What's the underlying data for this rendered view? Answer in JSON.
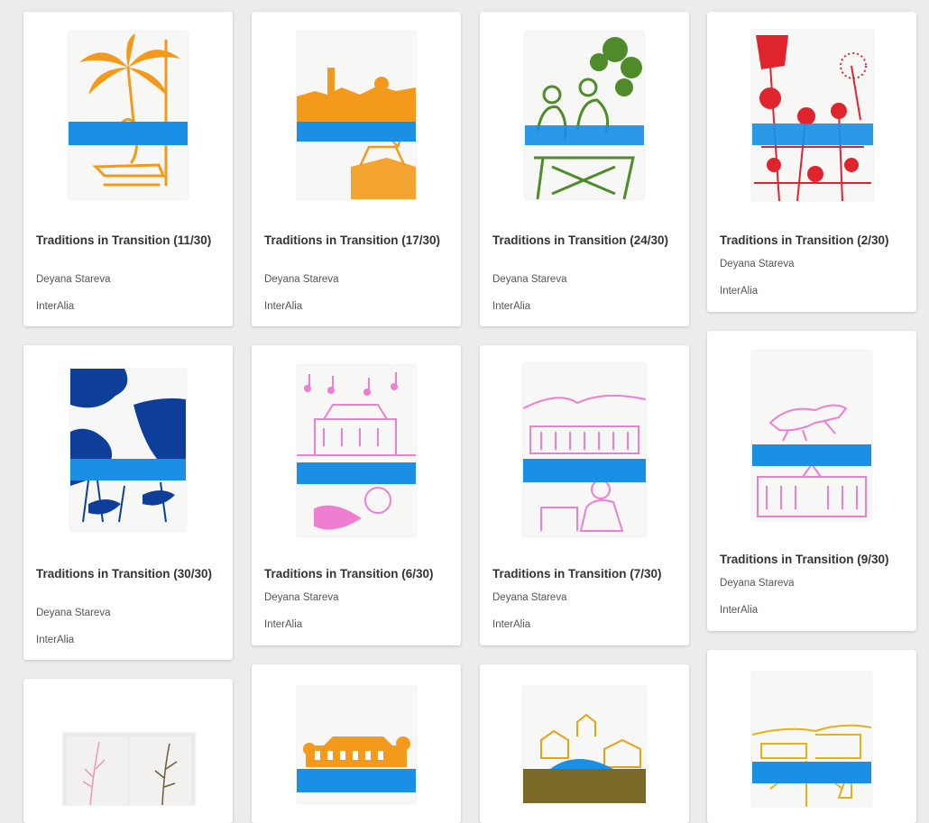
{
  "cards": [
    {
      "title": "Traditions in Transition (11/30)",
      "artist": "Deyana Stareva",
      "gallery": "InterAlia",
      "palette": "orange",
      "icon": "palm-tree-artwork"
    },
    {
      "title": "Traditions in Transition (17/30)",
      "artist": "Deyana Stareva",
      "gallery": "InterAlia",
      "palette": "orange",
      "icon": "coastal-town-artwork"
    },
    {
      "title": "Traditions in Transition (24/30)",
      "artist": "Deyana Stareva",
      "gallery": "InterAlia",
      "palette": "green",
      "icon": "people-table-artwork"
    },
    {
      "title": "Traditions in Transition (2/30)",
      "artist": "Deyana Stareva",
      "gallery": "InterAlia",
      "palette": "red",
      "icon": "flowers-artwork"
    },
    {
      "title": "Traditions in Transition (30/30)",
      "artist": "Deyana Stareva",
      "gallery": "InterAlia",
      "palette": "navy",
      "icon": "abstract-blue-artwork"
    },
    {
      "title": "Traditions in Transition (6/30)",
      "artist": "Deyana Stareva",
      "gallery": "InterAlia",
      "palette": "pink",
      "icon": "music-house-artwork"
    },
    {
      "title": "Traditions in Transition (7/30)",
      "artist": "Deyana Stareva",
      "gallery": "InterAlia",
      "palette": "pink",
      "icon": "building-figure-artwork"
    },
    {
      "title": "Traditions in Transition (9/30)",
      "artist": "Deyana Stareva",
      "gallery": "InterAlia",
      "palette": "pink",
      "icon": "horse-palace-artwork"
    },
    {
      "title": "",
      "artist": "",
      "gallery": "",
      "palette": "sketchbook",
      "icon": "sketchbook-artwork"
    },
    {
      "title": "",
      "artist": "",
      "gallery": "",
      "palette": "orange",
      "icon": "orange-building-artwork"
    },
    {
      "title": "",
      "artist": "",
      "gallery": "",
      "palette": "brown",
      "icon": "village-artwork"
    },
    {
      "title": "",
      "artist": "",
      "gallery": "",
      "palette": "yellow",
      "icon": "harbor-artwork"
    }
  ],
  "colors": {
    "band_blue": "#1a8fe6",
    "orange": "#f39a1c",
    "green": "#4f8a2b",
    "red": "#e0242e",
    "navy": "#0d3f9a",
    "pink": "#ee7fd0",
    "yellow": "#e8b01a",
    "brown": "#8a6a2a"
  }
}
